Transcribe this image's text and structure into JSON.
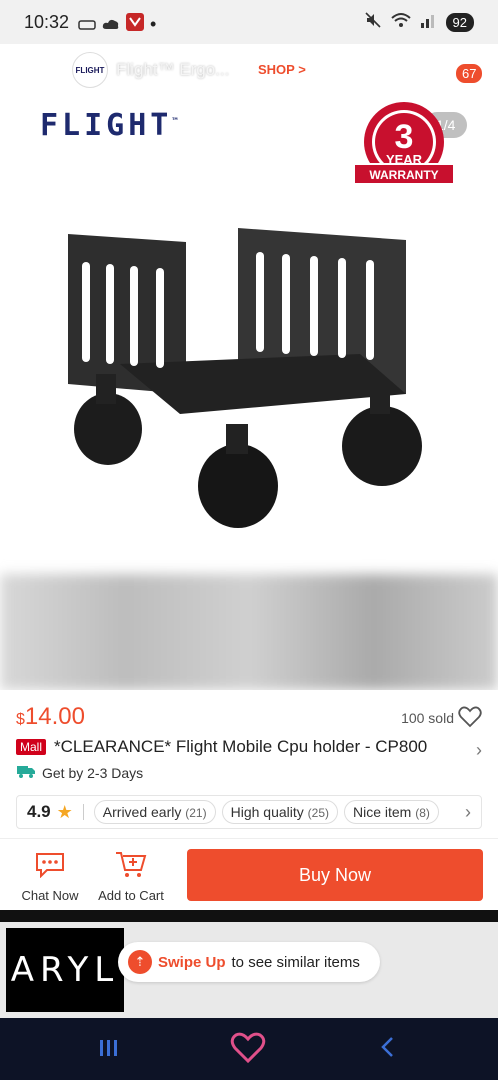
{
  "status_bar": {
    "time": "10:32",
    "battery": "92"
  },
  "header": {
    "store_logo_text": "FLIGHT",
    "store_name": "Flight™ Ergo...",
    "shop_label": "SHOP >",
    "cart_count": "67"
  },
  "gallery": {
    "brand": "FLIGHT",
    "image_counter": "1/4",
    "warranty_number": "3",
    "warranty_year": "YEAR",
    "warranty_word": "WARRANTY"
  },
  "product": {
    "currency": "$",
    "price": "14.00",
    "sold": "100 sold",
    "mall_badge": "Mall",
    "title": "*CLEARANCE*  Flight Mobile Cpu holder - CP800",
    "delivery": "Get by 2-3 Days"
  },
  "reviews": {
    "rating": "4.9",
    "chips": [
      {
        "label": "Arrived early",
        "count": "(21)"
      },
      {
        "label": "High quality",
        "count": "(25)"
      },
      {
        "label": "Nice item",
        "count": "(8)"
      }
    ]
  },
  "actions": {
    "chat_label": "Chat Now",
    "cart_label": "Add to Cart",
    "buy_label": "Buy Now"
  },
  "similar": {
    "brand_logo": "ARYL",
    "swipe_bold": "Swipe Up",
    "swipe_rest": "to see similar items"
  },
  "colors": {
    "accent": "#ee4d2d",
    "mall": "#d0011b",
    "brand_navy": "#1e2a6e"
  }
}
